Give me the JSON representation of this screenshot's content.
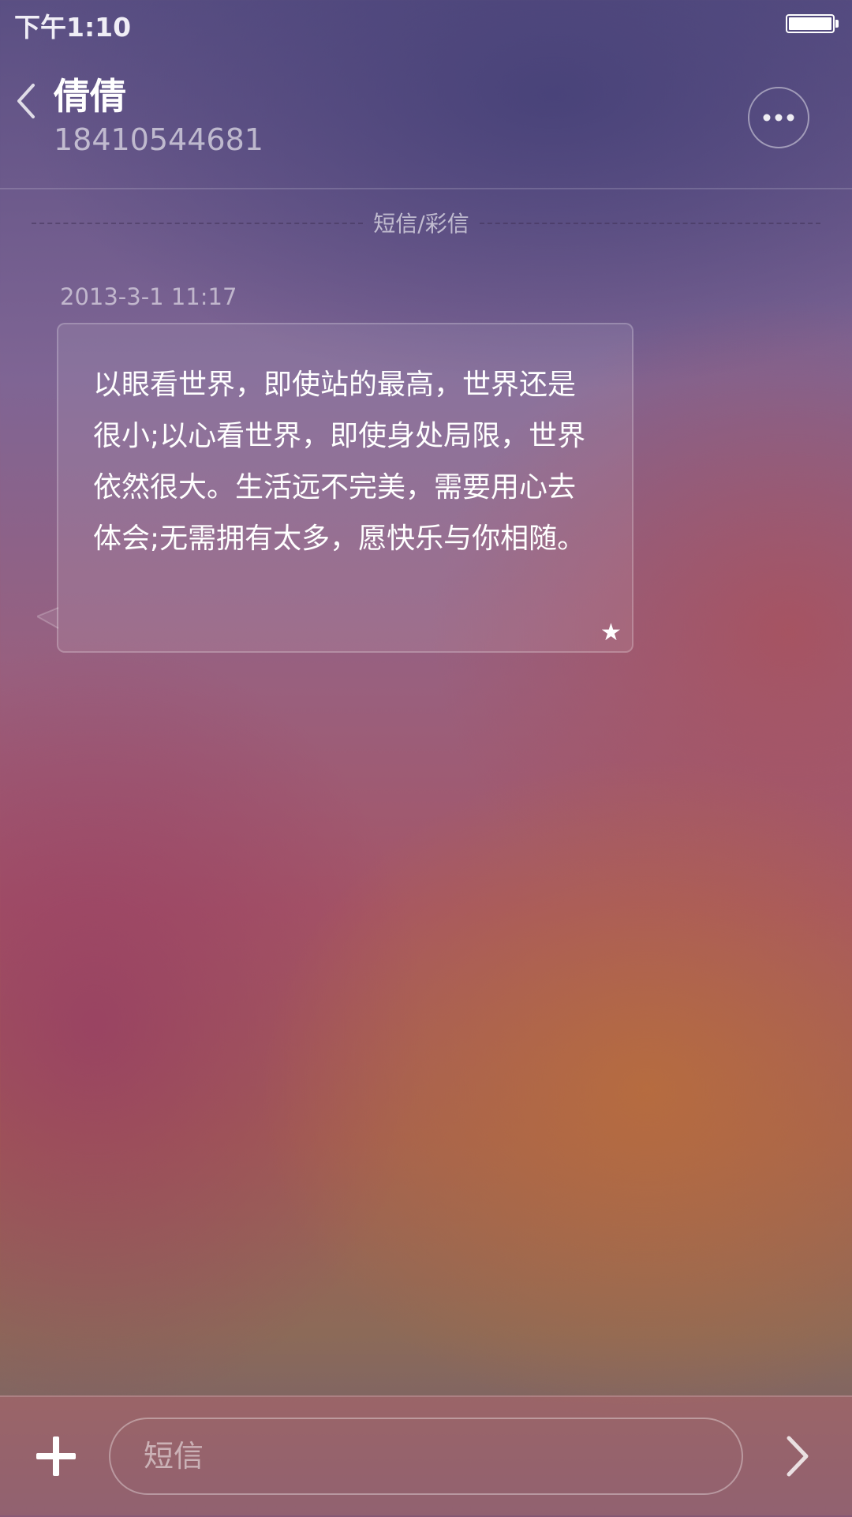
{
  "status_bar": {
    "time": "下午1:10",
    "battery_level": 1.0
  },
  "header": {
    "contact_name": "倩倩",
    "contact_number": "18410544681",
    "back_icon": "chevron-left-icon",
    "more_icon": "more-dots-icon"
  },
  "conversation": {
    "type_label": "短信/彩信",
    "messages": [
      {
        "timestamp": "2013-3-1 11:17",
        "text": "以眼看世界，即使站的最高，世界还是很小;以心看世界，即使身处局限，世界依然很大。生活远不完美，需要用心去体会;无需拥有太多，愿快乐与你相随。",
        "starred": true,
        "star_icon": "★"
      }
    ]
  },
  "input_bar": {
    "placeholder": "短信",
    "value": "",
    "add_icon": "plus-icon",
    "send_icon": "chevron-right-icon"
  },
  "colors": {
    "text_primary": "#ffffff",
    "bg_top": "#5a4f83",
    "bg_bottom_accent": "#b96e3c"
  }
}
